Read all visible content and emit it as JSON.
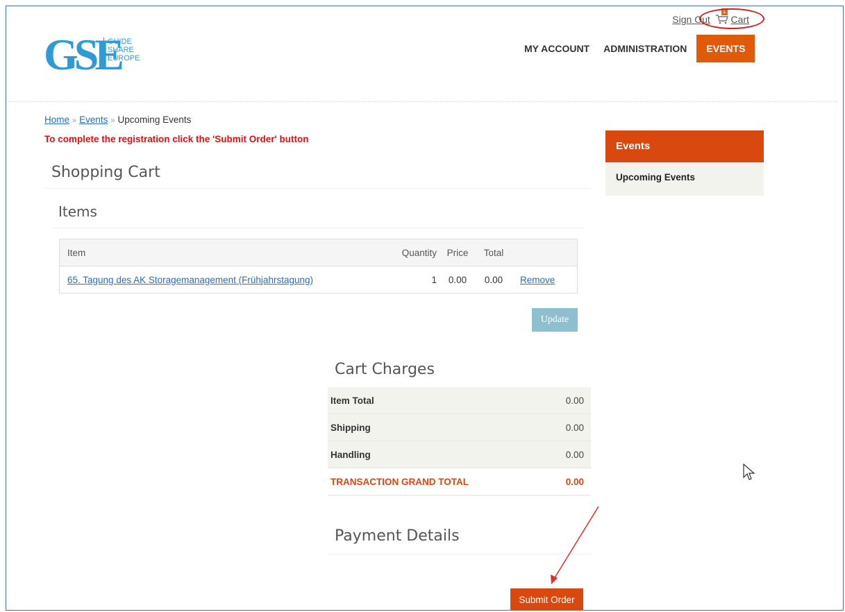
{
  "header": {
    "logo": {
      "letters": "GSE",
      "lines": [
        "GUIDE",
        "SHARE",
        "EUROPE"
      ]
    },
    "top_links": {
      "sign_out": "Sign Out",
      "cart": "Cart",
      "cart_count": "1"
    },
    "nav": [
      {
        "label": "MY ACCOUNT"
      },
      {
        "label": "ADMINISTRATION"
      },
      {
        "label": "EVENTS",
        "active": true
      }
    ]
  },
  "breadcrumb": {
    "home": "Home",
    "sep1": "»",
    "events": "Events",
    "sep2": "»",
    "current": "Upcoming Events"
  },
  "notice": "To complete the registration click the 'Submit Order' button",
  "cart": {
    "title": "Shopping Cart",
    "items_title": "Items",
    "columns": {
      "item": "Item",
      "quantity": "Quantity",
      "price": "Price",
      "total": "Total"
    },
    "rows": [
      {
        "item": "65. Tagung des AK Storagemanagement (Frühjahrstagung)",
        "quantity": "1",
        "price": "0.00",
        "total": "0.00",
        "action": "Remove"
      }
    ],
    "update_label": "Update"
  },
  "charges": {
    "title": "Cart Charges",
    "rows": [
      {
        "label": "Item Total",
        "value": "0.00"
      },
      {
        "label": "Shipping",
        "value": "0.00"
      },
      {
        "label": "Handling",
        "value": "0.00"
      }
    ],
    "grand": {
      "label": "TRANSACTION GRAND TOTAL",
      "value": "0.00"
    }
  },
  "payment": {
    "title": "Payment Details",
    "submit_label": "Submit Order"
  },
  "sidebar": {
    "heading": "Events",
    "items": [
      {
        "label": "Upcoming Events"
      }
    ]
  },
  "colors": {
    "accent": "#d9480f",
    "link": "#2a6ebb",
    "notice": "#e01010",
    "update_button": "#8fbfcf",
    "logo": "#2f9bd5"
  }
}
